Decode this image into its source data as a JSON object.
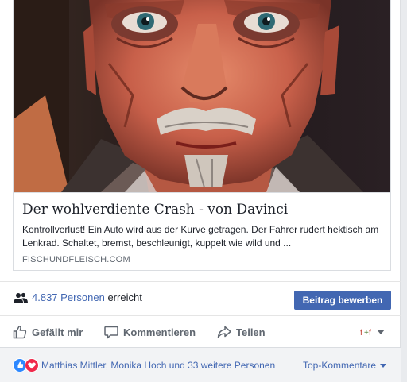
{
  "link_preview": {
    "title": "Der wohlverdiente Crash - von Davinci",
    "description": "Kontrollverlust! Ein Auto wird aus der Kurve getragen. Der Fahrer rudert hektisch am Lenkrad. Schaltet, bremst, beschleunigt, kuppelt wie wild und ...",
    "domain": "FISCHUNDFLEISCH.COM"
  },
  "reach": {
    "count": "4.837",
    "people": "Personen",
    "suffix": "erreicht",
    "icon": "people-icon",
    "promote_label": "Beitrag bewerben"
  },
  "actions": {
    "like_label": "Gefällt mir",
    "comment_label": "Kommentieren",
    "share_label": "Teilen",
    "audience_icon": "page-avatar-icon"
  },
  "reactions": {
    "icons": [
      "like-reaction-icon",
      "love-reaction-icon"
    ],
    "names": "Matthias Mittler, Monika Hoch und 33 weitere Personen",
    "sort_label": "Top-Kommentare"
  },
  "colors": {
    "accent": "#4267b2",
    "like": "#2d88ff",
    "love": "#f0284a",
    "muted": "#606770"
  }
}
